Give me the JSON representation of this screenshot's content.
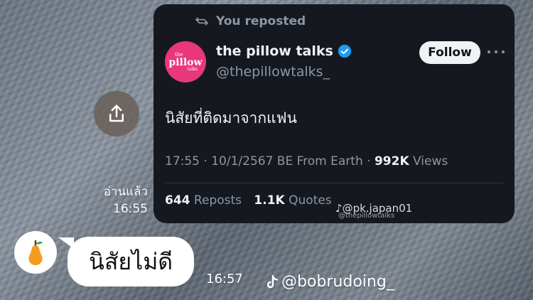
{
  "chat": {
    "read_label": "อ่านแล้ว",
    "read_time": "16:55",
    "message_text": "นิสัยไม่ดี",
    "message_time": "16:57"
  },
  "post": {
    "repost_label": "You reposted",
    "avatar_text": {
      "line1": "the",
      "line2": "pillow",
      "line3": "talks"
    },
    "display_name": "the pillow talks",
    "handle": "@thepillowtalks_",
    "follow_label": "Follow",
    "text": "นิสัยที่ติดมาจากแฟน",
    "meta": {
      "time": "17:55",
      "date": "10/1/2567 BE",
      "source": "From Earth",
      "views_count": "992K",
      "views_label": "Views"
    },
    "stats": {
      "reposts_count": "644",
      "reposts_label": "Reposts",
      "quotes_count": "1.1K",
      "quotes_label": "Quotes"
    }
  },
  "watermarks": {
    "card_credit": "@pk.japan01",
    "card_credit_small": "@thepillowtalks",
    "bottom_credit": "@bobrudoing_"
  },
  "colors": {
    "card_bg": "#15181f",
    "verified_blue": "#1d9bf0",
    "avatar_pink": "#e8377d",
    "follow_bg": "#eff3f4",
    "muted_text": "#8b98a5"
  },
  "icons": [
    "share-icon",
    "repost-icon",
    "verified-badge-icon",
    "more-icon",
    "pear-icon",
    "tiktok-icon"
  ]
}
